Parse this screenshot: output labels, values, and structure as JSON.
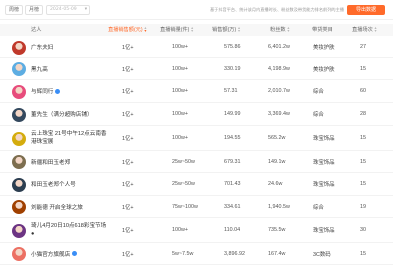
{
  "toolbar": {
    "buttons": [
      {
        "label": "周榜",
        "active": false
      },
      {
        "label": "月榜",
        "active": false
      }
    ],
    "date_placeholder": "2024-05-09",
    "note": "基于抖音平台、统计该月内直播时长、粉丝数及带货能力排名前列的主播",
    "export_label": "导出数据"
  },
  "columns": [
    {
      "label": "达人"
    },
    {
      "label": "直播销售额(元)",
      "sorted": true
    },
    {
      "label": "直播销量(件)"
    },
    {
      "label": "销售额(万)"
    },
    {
      "label": "粉丝数"
    },
    {
      "label": "带货类目"
    },
    {
      "label": "直播场次"
    }
  ],
  "rows": [
    {
      "name": "广东夫妇",
      "sales": "1亿+",
      "volume": "100w+",
      "amount": "575.86",
      "fans": "6,401.2w",
      "category": "美妆护肤",
      "sessions": "27",
      "avatar_color": "#c0392b"
    },
    {
      "name": "黑九高",
      "sales": "1亿+",
      "volume": "100w+",
      "amount": "330.19",
      "fans": "4,198.9w",
      "category": "美妆护肤",
      "sessions": "15",
      "avatar_color": "#5dade2"
    },
    {
      "name": "与辉同行",
      "sales": "1亿+",
      "volume": "100w+",
      "amount": "57.31",
      "fans": "2,010.7w",
      "category": "综合",
      "sessions": "60",
      "avatar_color": "#e74c7c",
      "verified": true
    },
    {
      "name": "董先生（满分超购店铺）",
      "sales": "1亿+",
      "volume": "100w+",
      "amount": "149.99",
      "fans": "3,369.4w",
      "category": "综合",
      "sessions": "28",
      "avatar_color": "#34495e"
    },
    {
      "name": "云上珠宝 21号中午12点云南香",
      "name2": "港珠宝展",
      "sales": "1亿+",
      "volume": "100w+",
      "amount": "194.55",
      "fans": "565.2w",
      "category": "珠宝饰品",
      "sessions": "15",
      "avatar_color": "#d4ac0d"
    },
    {
      "name": "新疆和田玉老郑",
      "sales": "1亿+",
      "volume": "25w~50w",
      "amount": "679.31",
      "fans": "149.1w",
      "category": "珠宝饰品",
      "sessions": "15",
      "avatar_color": "#7d6e4f"
    },
    {
      "name": "和田玉老郑个人号",
      "sales": "1亿+",
      "volume": "25w~50w",
      "amount": "701.43",
      "fans": "24.6w",
      "category": "珠宝饰品",
      "sessions": "15",
      "avatar_color": "#2c3e50"
    },
    {
      "name": "刘能德 开启全球之旅",
      "sales": "1亿+",
      "volume": "75w~100w",
      "amount": "334.61",
      "fans": "1,940.5w",
      "category": "综合",
      "sessions": "19",
      "avatar_color": "#a04000"
    },
    {
      "name": "琦儿4月20日10点618彩宝节场",
      "name2": "●",
      "sales": "1亿+",
      "volume": "100w+",
      "amount": "110.04",
      "fans": "735.5w",
      "category": "珠宝饰品",
      "sessions": "30",
      "avatar_color": "#6c3483"
    },
    {
      "name": "小猫官方旗舰店",
      "sales": "1亿+",
      "volume": "5w~7.5w",
      "amount": "3,896.92",
      "fans": "167.4w",
      "category": "3C数码",
      "sessions": "15",
      "avatar_color": "#ec7063",
      "verified": true
    }
  ],
  "colors": {
    "accent": "#ff6a2a",
    "header_bg": "#f7f7f7",
    "verified": "#3a8ef6"
  }
}
